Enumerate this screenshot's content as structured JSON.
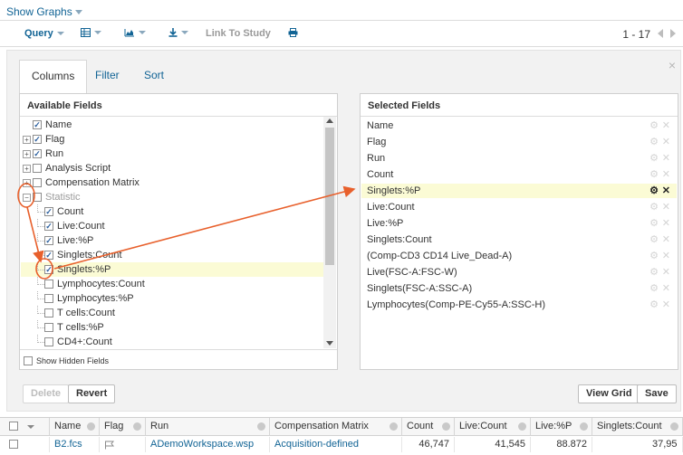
{
  "top": {
    "show_graphs": "Show Graphs"
  },
  "toolbar": {
    "query": "Query",
    "link_to_study": "Link To Study",
    "paging": "1 - 17"
  },
  "panel": {
    "tabs": [
      "Columns",
      "Filter",
      "Sort"
    ],
    "close": "×",
    "available": {
      "title": "Available Fields",
      "items": [
        {
          "label": "Name",
          "checked": true,
          "expander": "",
          "indent": 0
        },
        {
          "label": "Flag",
          "checked": true,
          "expander": "+",
          "indent": 0
        },
        {
          "label": "Run",
          "checked": true,
          "expander": "+",
          "indent": 0
        },
        {
          "label": "Analysis Script",
          "checked": false,
          "expander": "+",
          "indent": 0
        },
        {
          "label": "Compensation Matrix",
          "checked": false,
          "expander": "+",
          "indent": 0
        },
        {
          "label": "Statistic",
          "checked": false,
          "expander": "−",
          "indent": 0,
          "dim": true
        },
        {
          "label": "Count",
          "checked": true,
          "indent": 1
        },
        {
          "label": "Live:Count",
          "checked": true,
          "indent": 1
        },
        {
          "label": "Live:%P",
          "checked": true,
          "indent": 1
        },
        {
          "label": "Singlets:Count",
          "checked": true,
          "indent": 1
        },
        {
          "label": "Singlets:%P",
          "checked": true,
          "indent": 1,
          "highlight": true
        },
        {
          "label": "Lymphocytes:Count",
          "checked": false,
          "indent": 1
        },
        {
          "label": "Lymphocytes:%P",
          "checked": false,
          "indent": 1
        },
        {
          "label": "T cells:Count",
          "checked": false,
          "indent": 1
        },
        {
          "label": "T cells:%P",
          "checked": false,
          "indent": 1
        },
        {
          "label": "CD4+:Count",
          "checked": false,
          "indent": 1
        }
      ],
      "show_hidden": "Show Hidden Fields"
    },
    "selected": {
      "title": "Selected Fields",
      "items": [
        {
          "label": "Name"
        },
        {
          "label": "Flag"
        },
        {
          "label": "Run"
        },
        {
          "label": "Count"
        },
        {
          "label": "Singlets:%P",
          "highlight": true
        },
        {
          "label": "Live:Count"
        },
        {
          "label": "Live:%P"
        },
        {
          "label": "Singlets:Count"
        },
        {
          "label": "(Comp-CD3 CD14 Live_Dead-A)"
        },
        {
          "label": "Live(FSC-A:FSC-W)"
        },
        {
          "label": "Singlets(FSC-A:SSC-A)"
        },
        {
          "label": "Lymphocytes(Comp-PE-Cy55-A:SSC-H)"
        }
      ]
    },
    "buttons": {
      "delete": "Delete",
      "revert": "Revert",
      "view_grid": "View Grid",
      "save": "Save"
    }
  },
  "grid": {
    "columns": [
      "Name",
      "Flag",
      "Run",
      "Compensation Matrix",
      "Count",
      "Live:Count",
      "Live:%P",
      "Singlets:Count"
    ],
    "row": {
      "name": "B2.fcs",
      "run": "ADemoWorkspace.wsp",
      "comp": "Acquisition-defined",
      "count": "46,747",
      "live_count": "41,545",
      "live_p": "88.872",
      "singlets_count": "37,95"
    }
  },
  "colors": {
    "link": "#126495",
    "highlight": "#fbfbd5",
    "annotation": "#e8602c"
  }
}
